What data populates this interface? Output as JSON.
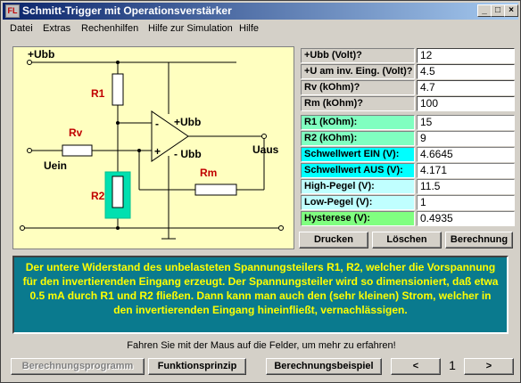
{
  "window": {
    "title": "Schmitt-Trigger mit Operationsverstärker",
    "icon_text": "FL",
    "controls": {
      "minimize": "_",
      "maximize": "□",
      "close": "×"
    }
  },
  "menu": [
    {
      "label": "Datei"
    },
    {
      "label": "Extras"
    },
    {
      "label": "Rechenhilfen"
    },
    {
      "label": "Hilfe zur Simulation"
    },
    {
      "label": "Hilfe"
    }
  ],
  "circuit": {
    "labels": {
      "ubb_top": "+Ubb",
      "r1": "R1",
      "rv": "Rv",
      "uein": "Uein",
      "r2": "R2",
      "op_plus": "+Ubb",
      "op_minus": "- Ubb",
      "minus_sign": "-",
      "plus_sign": "+",
      "uaus": "Uaus",
      "rm": "Rm"
    },
    "colors": {
      "background": "#ffffc0",
      "highlight": "#00e0b0",
      "label_red": "#c00000"
    }
  },
  "inputs": [
    {
      "label": "+Ubb (Volt)?",
      "value": "12"
    },
    {
      "label": "+U am inv. Eing. (Volt)?",
      "value": "4.5"
    },
    {
      "label": "Rv  (kOhm)?",
      "value": "4.7"
    },
    {
      "label": "Rm  (kOhm)?",
      "value": "100"
    }
  ],
  "results": [
    {
      "label": "R1  (kOhm):",
      "value": "15",
      "color": "#80ffc0"
    },
    {
      "label": "R2  (kOhm):",
      "value": "9",
      "color": "#80ffc0"
    },
    {
      "label": "Schwellwert EIN (V):",
      "value": "4.6645",
      "color": "#00ffff"
    },
    {
      "label": "Schwellwert AUS (V):",
      "value": "4.171",
      "color": "#00ffff"
    },
    {
      "label": "High-Pegel (V):",
      "value": "11.5",
      "color": "#c0ffff"
    },
    {
      "label": "Low-Pegel (V):",
      "value": "1",
      "color": "#c0ffff"
    },
    {
      "label": "Hysterese (V):",
      "value": "0.4935",
      "color": "#80ff80"
    }
  ],
  "actions": {
    "drucken": "Drucken",
    "loeschen": "Löschen",
    "berechnung": "Berechnung"
  },
  "info_text": "Der untere Widerstand des unbelasteten Spannungsteilers R1, R2, welcher die Vorspannung für den invertierenden Eingang erzeugt. Der Spannungsteiler wird so dimensioniert, daß etwa 0.5 mA durch R1 und R2 fließen. Dann kann man auch den (sehr kleinen) Strom, welcher in den invertierenden Eingang hineinfließt, vernachlässigen.",
  "hint": "Fahren Sie mit der Maus auf die Felder, um mehr zu erfahren!",
  "footer": {
    "berechnungsprogramm": "Berechnungsprogramm",
    "funktionsprinzip": "Funktionsprinzip",
    "berechnungsbeispiel": "Berechnungsbeispiel",
    "prev": "<",
    "page": "1",
    "next": ">"
  }
}
